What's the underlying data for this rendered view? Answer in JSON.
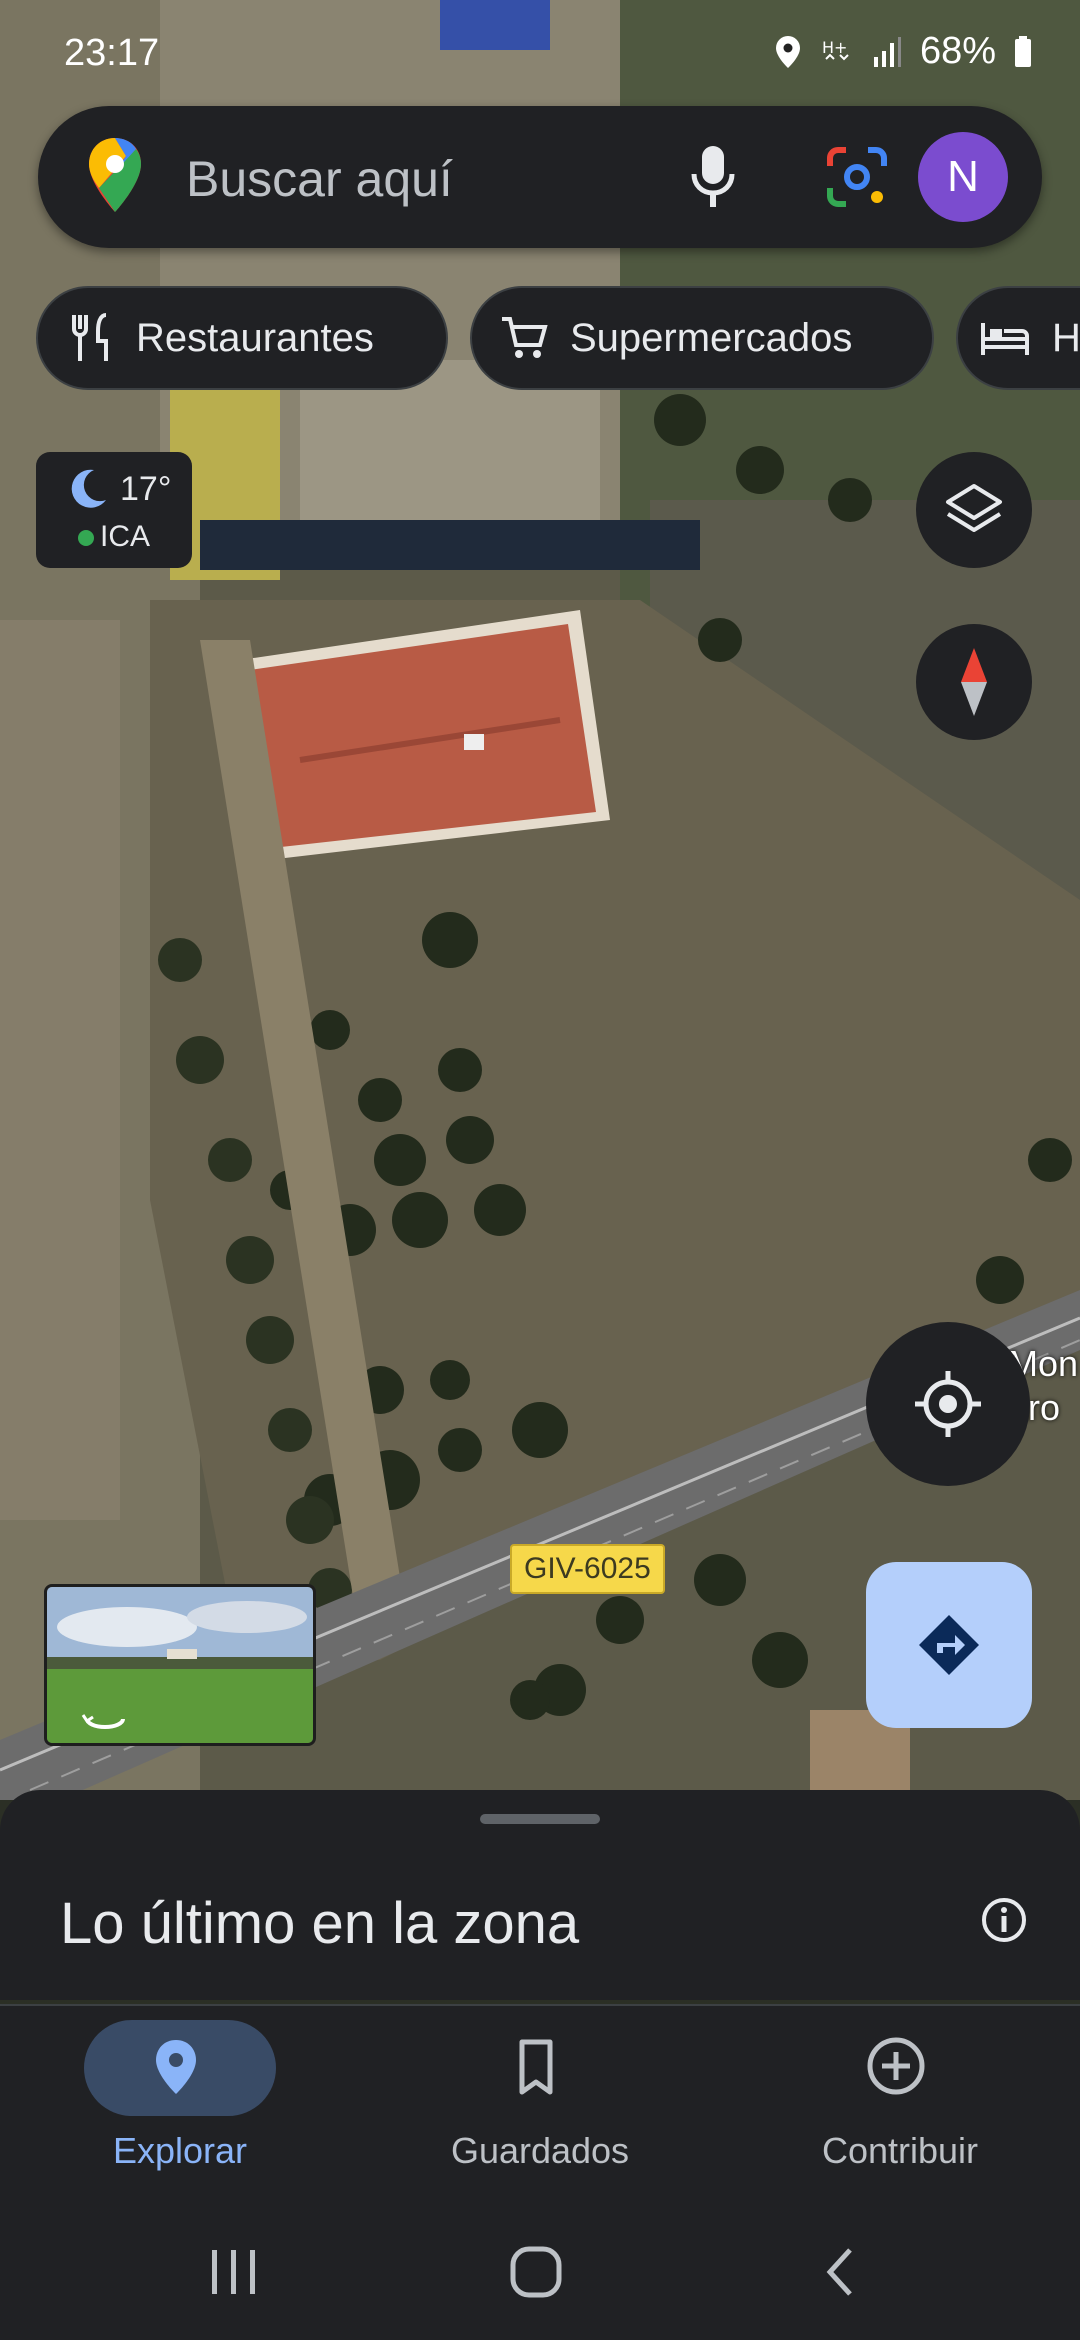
{
  "status_bar": {
    "time": "23:17",
    "battery": "68%"
  },
  "search": {
    "placeholder": "Buscar aquí",
    "avatar_letter": "N"
  },
  "chips": [
    {
      "label": "Restaurantes",
      "icon": "cutlery-icon"
    },
    {
      "label": "Supermercados",
      "icon": "shopping-cart-icon"
    },
    {
      "label": "H",
      "icon": "hotel-bed-icon"
    }
  ],
  "weather": {
    "temp": "17°",
    "aqi_label": "ICA"
  },
  "map": {
    "road_label": "GIV-6025",
    "place_label_line1": "Mon",
    "place_label_line2": "aro"
  },
  "sheet": {
    "title": "Lo último en la zona"
  },
  "nav": {
    "items": [
      {
        "label": "Explorar",
        "active": true
      },
      {
        "label": "Guardados",
        "active": false
      },
      {
        "label": "Contribuir",
        "active": false
      }
    ]
  },
  "colors": {
    "accent": "#8ab4f8",
    "surface": "#202124",
    "directions_bg": "#b4cffb"
  }
}
